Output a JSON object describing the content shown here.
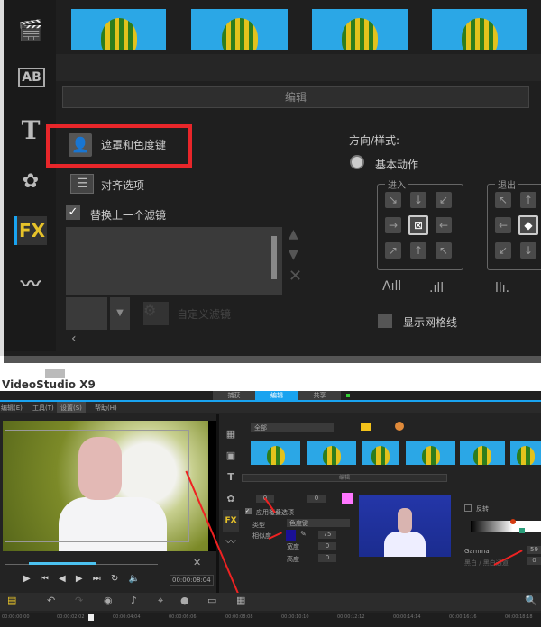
{
  "top_panel": {
    "edit_header": "编辑",
    "options": [
      {
        "label": "遮罩和色度键",
        "icon": "mask-person-icon",
        "highlighted": true
      },
      {
        "label": "对齐选项",
        "icon": "align-icon"
      }
    ],
    "replace_filter_label": "替换上一个滤镜",
    "replace_filter_checked": true,
    "custom_filter_label": "自定义滤镜",
    "direction_label": "方向/样式:",
    "basic_motion_label": "基本动作",
    "enter_label": "进入",
    "exit_label": "退出",
    "show_grid_label": "显示网格线",
    "sidebar_icons": [
      "media-icon",
      "text-ab-icon",
      "title-t-icon",
      "transition-icon",
      "fx-icon",
      "path-icon"
    ],
    "fx_label": "FX",
    "accent_red": "#e8262a"
  },
  "bottom_panel": {
    "app_title": "VideoStudio X9",
    "tabs": [
      "捕获",
      "编辑",
      "共享"
    ],
    "active_tab": "编辑",
    "menu": [
      "编辑(E)",
      "工具(T)",
      "设置(S)",
      "帮助(H)"
    ],
    "timecode": "00:00:08:04",
    "library_filter": "全部",
    "edit_header": "编辑",
    "overlay_options_label": "应用覆叠选项",
    "type_label": "类型",
    "type_value": "色度键",
    "similarity_label": "相似度",
    "similarity_value": "75",
    "width_label": "宽度",
    "width_value": "0",
    "height_label": "高度",
    "height_value": "0",
    "border_value": "0",
    "transparency_value": "0",
    "invert_label": "反转",
    "gamma_label": "Gamma",
    "gamma_value": "59",
    "blend_label": "黑白 / 黑白通道",
    "blend_value": "0",
    "key_color": "#1a1096",
    "border_color": "#ff77ff",
    "ruler_ticks": [
      "00:00:00:00",
      "00:00:02:02",
      "00:00:04:04",
      "00:00:06:06",
      "00:00:08:08",
      "00:00:10:10",
      "00:00:12:12",
      "00:00:14:14",
      "00:00:16:16",
      "00:00:18:18"
    ],
    "accent_blue": "#19a3f0"
  }
}
